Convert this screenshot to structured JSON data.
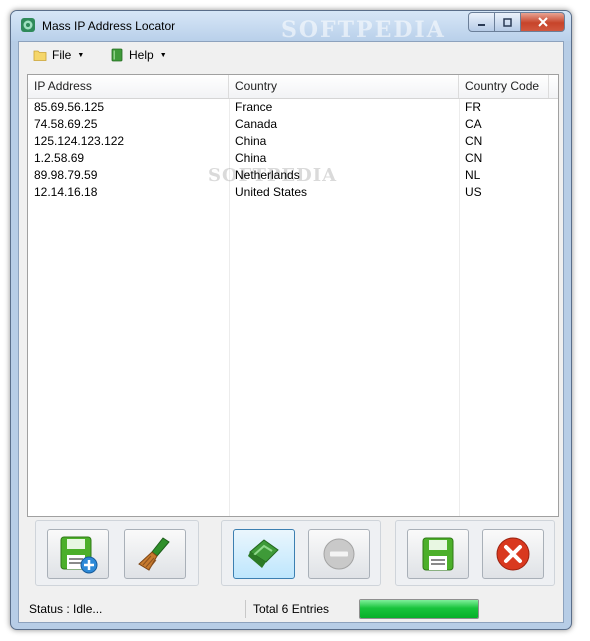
{
  "window": {
    "title": "Mass IP Address Locator",
    "watermark": "SOFTPEDIA"
  },
  "menu": {
    "file_label": "File",
    "help_label": "Help"
  },
  "table": {
    "columns": [
      "IP Address",
      "Country",
      "Country Code"
    ],
    "rows": [
      [
        "85.69.56.125",
        "France",
        "FR"
      ],
      [
        "74.58.69.25",
        "Canada",
        "CA"
      ],
      [
        "125.124.123.122",
        "China",
        "CN"
      ],
      [
        "1.2.58.69",
        "China",
        "CN"
      ],
      [
        "89.98.79.59",
        "Netherlands",
        "NL"
      ],
      [
        "12.14.16.18",
        "United States",
        "US"
      ]
    ]
  },
  "toolbar": {
    "icons": [
      "save-add-icon",
      "broom-icon",
      "flag-icon",
      "remove-icon",
      "save-icon",
      "close-icon"
    ]
  },
  "status": {
    "text": "Status : Idle...",
    "entries": "Total 6 Entries",
    "progress": 1.0
  },
  "colors": {
    "progress_green": "#19c43c",
    "close_red": "#d9391f",
    "save_green": "#4caf2a"
  }
}
